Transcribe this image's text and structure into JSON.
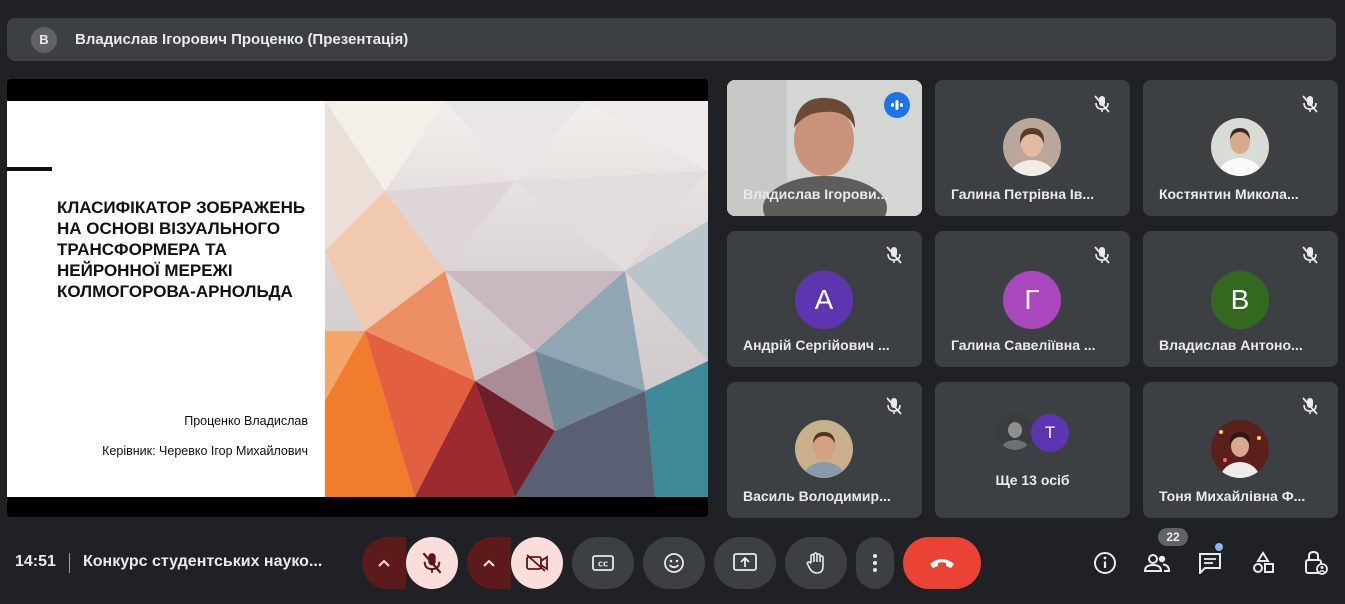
{
  "presenter_bar": {
    "avatar_letter": "В",
    "title": "Владислав Ігорович Проценко (Презентація)"
  },
  "slide": {
    "title": "Класифікатор зображень\nна основі візуального\nтрансформера та\nнейронної мережі\nКолмогорова-Арнольда",
    "author": "Проценко Владислав",
    "supervisor": "Керівник: Черевко Ігор Михайлович"
  },
  "participants": [
    {
      "name": "Владислав Ігорови...",
      "state": "speaking",
      "icon": "speaking-icon"
    },
    {
      "name": "Галина Петрівна Ів...",
      "state": "muted",
      "icon": "mic-off-icon"
    },
    {
      "name": "Костянтин Микола...",
      "state": "muted",
      "icon": "mic-off-icon"
    },
    {
      "name": "Андрій Сергійович ...",
      "state": "muted",
      "letter": "А",
      "color": "#5e35b1"
    },
    {
      "name": "Галина Савеліївна ...",
      "state": "muted",
      "letter": "Г",
      "color": "#9c27b0"
    },
    {
      "name": "Владислав Антоно...",
      "state": "muted",
      "letter": "В",
      "color": "#33691e"
    },
    {
      "name": "Василь Володимир...",
      "state": "muted"
    },
    {
      "name": "Тоня Михайлівна Ф...",
      "state": "muted"
    }
  ],
  "more_tile": {
    "avatar_letter": "Т",
    "label": "Ще 13 осіб"
  },
  "bottom_bar": {
    "time": "14:51",
    "meeting_name": "Конкурс студентських науко...",
    "participant_count": "22"
  },
  "colors": {
    "background": "#202124",
    "tile": "#3c4043",
    "accent_blue": "#1a73e8",
    "leave_red": "#ea4335",
    "muted_control": "#f9dedc"
  }
}
